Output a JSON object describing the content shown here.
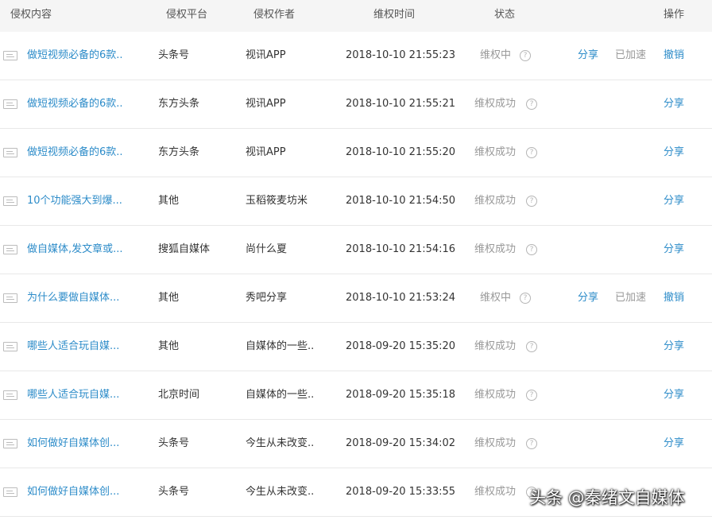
{
  "header": {
    "content": "侵权内容",
    "platform": "侵权平台",
    "author": "侵权作者",
    "time": "维权时间",
    "status": "状态",
    "action": "操作"
  },
  "rows": [
    {
      "title": "做短视频必备的6款..",
      "platform": "头条号",
      "author": "视讯APP",
      "time": "2018-10-10 21:55:23",
      "status": "维权中",
      "share": "分享",
      "accelerated": "已加速",
      "action": "撤销"
    },
    {
      "title": "做短视频必备的6款..",
      "platform": "东方头条",
      "author": "视讯APP",
      "time": "2018-10-10 21:55:21",
      "status": "维权成功",
      "action": "分享"
    },
    {
      "title": "做短视频必备的6款..",
      "platform": "东方头条",
      "author": "视讯APP",
      "time": "2018-10-10 21:55:20",
      "status": "维权成功",
      "action": "分享"
    },
    {
      "title": "10个功能强大到爆...",
      "platform": "其他",
      "author": "玉稻筱麦坊米",
      "time": "2018-10-10 21:54:50",
      "status": "维权成功",
      "action": "分享"
    },
    {
      "title": "做自媒体,发文章或...",
      "platform": "搜狐自媒体",
      "author": "尚什么夏",
      "time": "2018-10-10 21:54:16",
      "status": "维权成功",
      "action": "分享"
    },
    {
      "title": "为什么要做自媒体...",
      "platform": "其他",
      "author": "秀吧分享",
      "time": "2018-10-10 21:53:24",
      "status": "维权中",
      "share": "分享",
      "accelerated": "已加速",
      "action": "撤销"
    },
    {
      "title": "哪些人适合玩自媒...",
      "platform": "其他",
      "author": "自媒体的一些..",
      "time": "2018-09-20 15:35:20",
      "status": "维权成功",
      "action": "分享"
    },
    {
      "title": "哪些人适合玩自媒...",
      "platform": "北京时间",
      "author": "自媒体的一些..",
      "time": "2018-09-20 15:35:18",
      "status": "维权成功",
      "action": "分享"
    },
    {
      "title": "如何做好自媒体创...",
      "platform": "头条号",
      "author": "今生从未改变..",
      "time": "2018-09-20 15:34:02",
      "status": "维权成功",
      "action": "分享"
    },
    {
      "title": "如何做好自媒体创...",
      "platform": "头条号",
      "author": "今生从未改变..",
      "time": "2018-09-20 15:33:55",
      "status": "维权成功",
      "action": ""
    }
  ],
  "watermark": "头条 @秦绪文自媒体",
  "colors": {
    "link": "#2d8cc9",
    "muted": "#999999",
    "header_bg": "#f5f5f5",
    "border": "#e8e8e8"
  }
}
